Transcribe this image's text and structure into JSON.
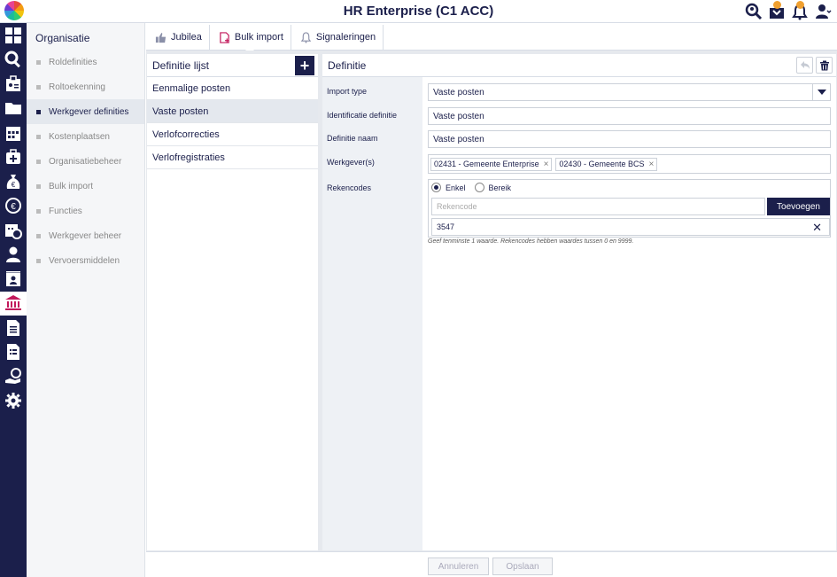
{
  "app": {
    "title": "HR Enterprise (C1 ACC)"
  },
  "top_icons": [
    "search-person-icon",
    "inbox-icon",
    "bell-icon",
    "user-icon"
  ],
  "rail_icons": [
    "dashboard-icon",
    "search-icon",
    "id-card-icon",
    "folder-icon",
    "calendar-icon",
    "medical-kit-icon",
    "money-bag-icon",
    "euro-coin-icon",
    "calendar-clock-icon",
    "person-icon",
    "contact-card-icon",
    "bank-icon",
    "document-icon",
    "document-list-icon",
    "hand-coin-icon",
    "gear-icon"
  ],
  "subnav": {
    "title": "Organisatie",
    "items": [
      {
        "label": "Roldefinities"
      },
      {
        "label": "Roltoekenning"
      },
      {
        "label": "Werkgever definities",
        "active": true
      },
      {
        "label": "Kostenplaatsen"
      },
      {
        "label": "Organisatiebeheer"
      },
      {
        "label": "Bulk import"
      },
      {
        "label": "Functies"
      },
      {
        "label": "Werkgever beheer"
      },
      {
        "label": "Vervoersmiddelen"
      }
    ]
  },
  "tabs": [
    {
      "label": "Jubilea",
      "icon": "thumbs-up-icon"
    },
    {
      "label": "Bulk import",
      "icon": "document-plus-icon",
      "active": true
    },
    {
      "label": "Signaleringen",
      "icon": "bell-icon"
    }
  ],
  "list": {
    "title": "Definitie lijst",
    "add_label": "+",
    "items": [
      "Eenmalige posten",
      "Vaste posten",
      "Verlofcorrecties",
      "Verlofregistraties"
    ],
    "active_index": 1
  },
  "detail": {
    "title": "Definitie",
    "labels": {
      "import_type": "Import type",
      "identificatie": "Identificatie definitie",
      "naam": "Definitie naam",
      "werkgever": "Werkgever(s)",
      "rekencodes": "Rekencodes"
    },
    "import_type_value": "Vaste posten",
    "identificatie_value": "Vaste posten",
    "naam_value": "Vaste posten",
    "werkgevers": [
      "02431 - Gemeente Enterprise",
      "02430 - Gemeente BCS"
    ],
    "radio_enkel": "Enkel",
    "radio_bereik": "Bereik",
    "rekencode_placeholder": "Rekencode",
    "toevoegen_label": "Toevoegen",
    "codes": [
      "3547"
    ],
    "hint": "Geef tenminste 1 waarde. Rekencodes hebben waardes tussen 0 en 9999."
  },
  "footer": {
    "cancel_label": "Annuleren",
    "save_label": "Opslaan"
  },
  "colors": {
    "navy": "#1b1f4b",
    "accent": "#c2185b"
  }
}
